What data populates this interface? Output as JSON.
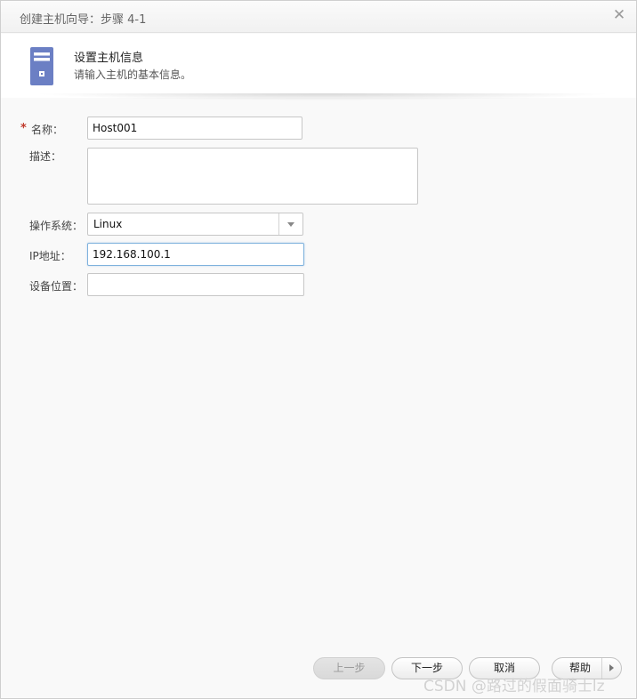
{
  "window": {
    "title": "创建主机向导：步骤 4-1",
    "close_glyph": "✕"
  },
  "header": {
    "icon": "server-icon",
    "step_title": "设置主机信息",
    "step_desc": "请输入主机的基本信息。"
  },
  "form": {
    "required_mark": "*",
    "name": {
      "label": "名称：",
      "value": "Host001"
    },
    "description": {
      "label": "描述：",
      "value": ""
    },
    "os": {
      "label": "操作系统：",
      "value": "Linux"
    },
    "ip": {
      "label": "IP地址：",
      "value": "192.168.100.1"
    },
    "location": {
      "label": "设备位置：",
      "value": ""
    }
  },
  "buttons": {
    "prev": "上一步",
    "next": "下一步",
    "cancel": "取消",
    "help": "帮助"
  },
  "watermark": "CSDN @路过的假面骑士lz"
}
